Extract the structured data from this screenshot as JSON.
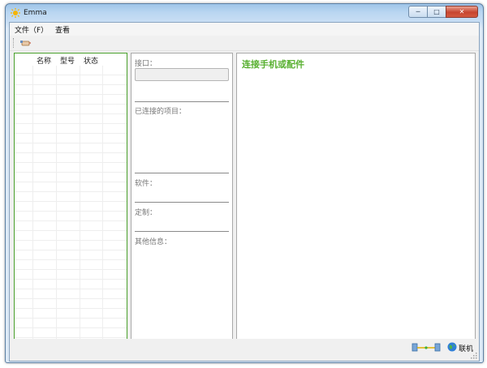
{
  "window": {
    "title": "Emma",
    "minimize_glyph": "─",
    "maximize_glyph": "□",
    "close_glyph": "✕",
    "accent_color": "#58b030"
  },
  "menubar": {
    "items": [
      {
        "label": "文件（F）"
      },
      {
        "label": "查看"
      }
    ]
  },
  "toolbar": {
    "icon": "connect-tool-icon"
  },
  "device_list": {
    "columns": [
      "名称",
      "型号",
      "状态"
    ],
    "rows": []
  },
  "info_panel": {
    "port_label": "接口：",
    "port_value": "",
    "connected_items_label": "已连接的项目：",
    "software_label": "软件：",
    "custom_label": "定制：",
    "other_info_label": "其他信息："
  },
  "main_panel": {
    "title": "连接手机或配件"
  },
  "statusbar": {
    "connection_icon": "device-connection-icon",
    "network_icon": "globe-icon",
    "status_text": "联机"
  }
}
